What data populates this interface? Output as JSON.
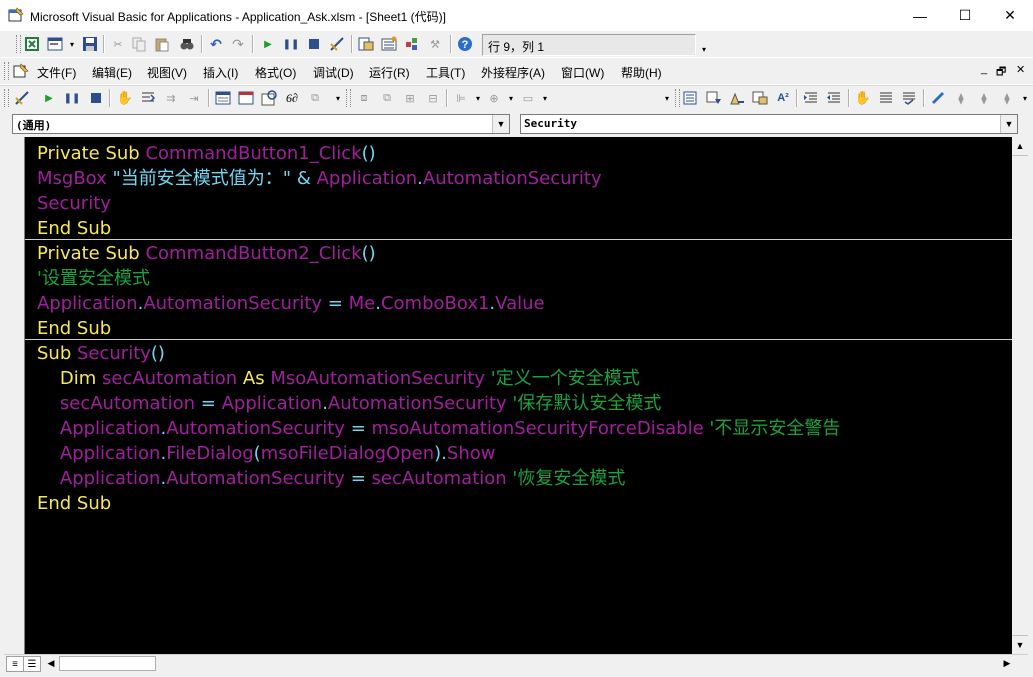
{
  "window": {
    "title": "Microsoft Visual Basic for Applications - Application_Ask.xlsm - [Sheet1 (代码)]",
    "minimize_glyph": "—",
    "maximize_glyph": "☐",
    "close_glyph": "✕"
  },
  "toolbar": {
    "position_text": "行 9，列 1"
  },
  "menu": {
    "items": [
      "文件(F)",
      "编辑(E)",
      "视图(V)",
      "插入(I)",
      "格式(O)",
      "调试(D)",
      "运行(R)",
      "工具(T)",
      "外接程序(A)",
      "窗口(W)",
      "帮助(H)"
    ],
    "mdi_minimize": "_",
    "mdi_restore": "🗗",
    "mdi_close": "✕"
  },
  "object_combo": {
    "value": "(通用)"
  },
  "procedure_combo": {
    "value": "Security"
  },
  "code_lines": [
    "Private Sub CommandButton1_Click()",
    "MsgBox \"当前安全模式值为：\" & Application.AutomationSecurity",
    "Security",
    "End Sub",
    "Private Sub CommandButton2_Click()",
    "'设置安全模式",
    "Application.AutomationSecurity = Me.ComboBox1.Value",
    "End Sub",
    "Sub Security()",
    "    Dim secAutomation As MsoAutomationSecurity '定义一个安全模式",
    "    secAutomation = Application.AutomationSecurity '保存默认安全模式",
    "    Application.AutomationSecurity = msoAutomationSecurityForceDisable '不显示安全警告",
    "    Application.FileDialog(msoFileDialogOpen).Show",
    "    Application.AutomationSecurity = secAutomation '恢复安全模式",
    "End Sub"
  ],
  "colors": {
    "editor_background": "#000000",
    "keyword": "#f7e85a",
    "identifier": "#a31e9e",
    "string": "#6fd8f5",
    "comment": "#1aa33c"
  },
  "icons": {
    "app": "vba-editor-icon",
    "toolbar1": [
      "view-excel-icon",
      "insert-userform-icon",
      "save-icon",
      "cut-icon",
      "copy-icon",
      "paste-icon",
      "find-icon",
      "undo-icon",
      "redo-icon",
      "run-icon",
      "break-icon",
      "reset-icon",
      "design-mode-icon",
      "project-explorer-icon",
      "properties-icon",
      "object-browser-icon",
      "toolbox-icon",
      "help-icon"
    ],
    "toolbar3": [
      "design-icon",
      "run-icon",
      "break-icon",
      "reset-icon",
      "toggle-breakpoint-icon",
      "step-into-icon",
      "step-over-icon",
      "step-out-icon",
      "locals-icon",
      "immediate-icon",
      "watch-icon",
      "quick-watch-icon",
      "call-stack-icon",
      "bring-to-front-icon",
      "send-to-back-icon",
      "group-icon",
      "ungroup-icon",
      "align-icon",
      "center-icon",
      "make-same-size-icon",
      "list-properties-icon",
      "list-constants-icon",
      "quick-info-icon",
      "parameter-info-icon",
      "complete-word-icon",
      "indent-icon",
      "outdent-icon",
      "toggle-breakpoint-hand-icon",
      "comment-block-icon",
      "uncomment-block-icon",
      "toggle-bookmark-icon",
      "next-bookmark-icon",
      "prev-bookmark-icon",
      "clear-bookmarks-icon"
    ]
  }
}
